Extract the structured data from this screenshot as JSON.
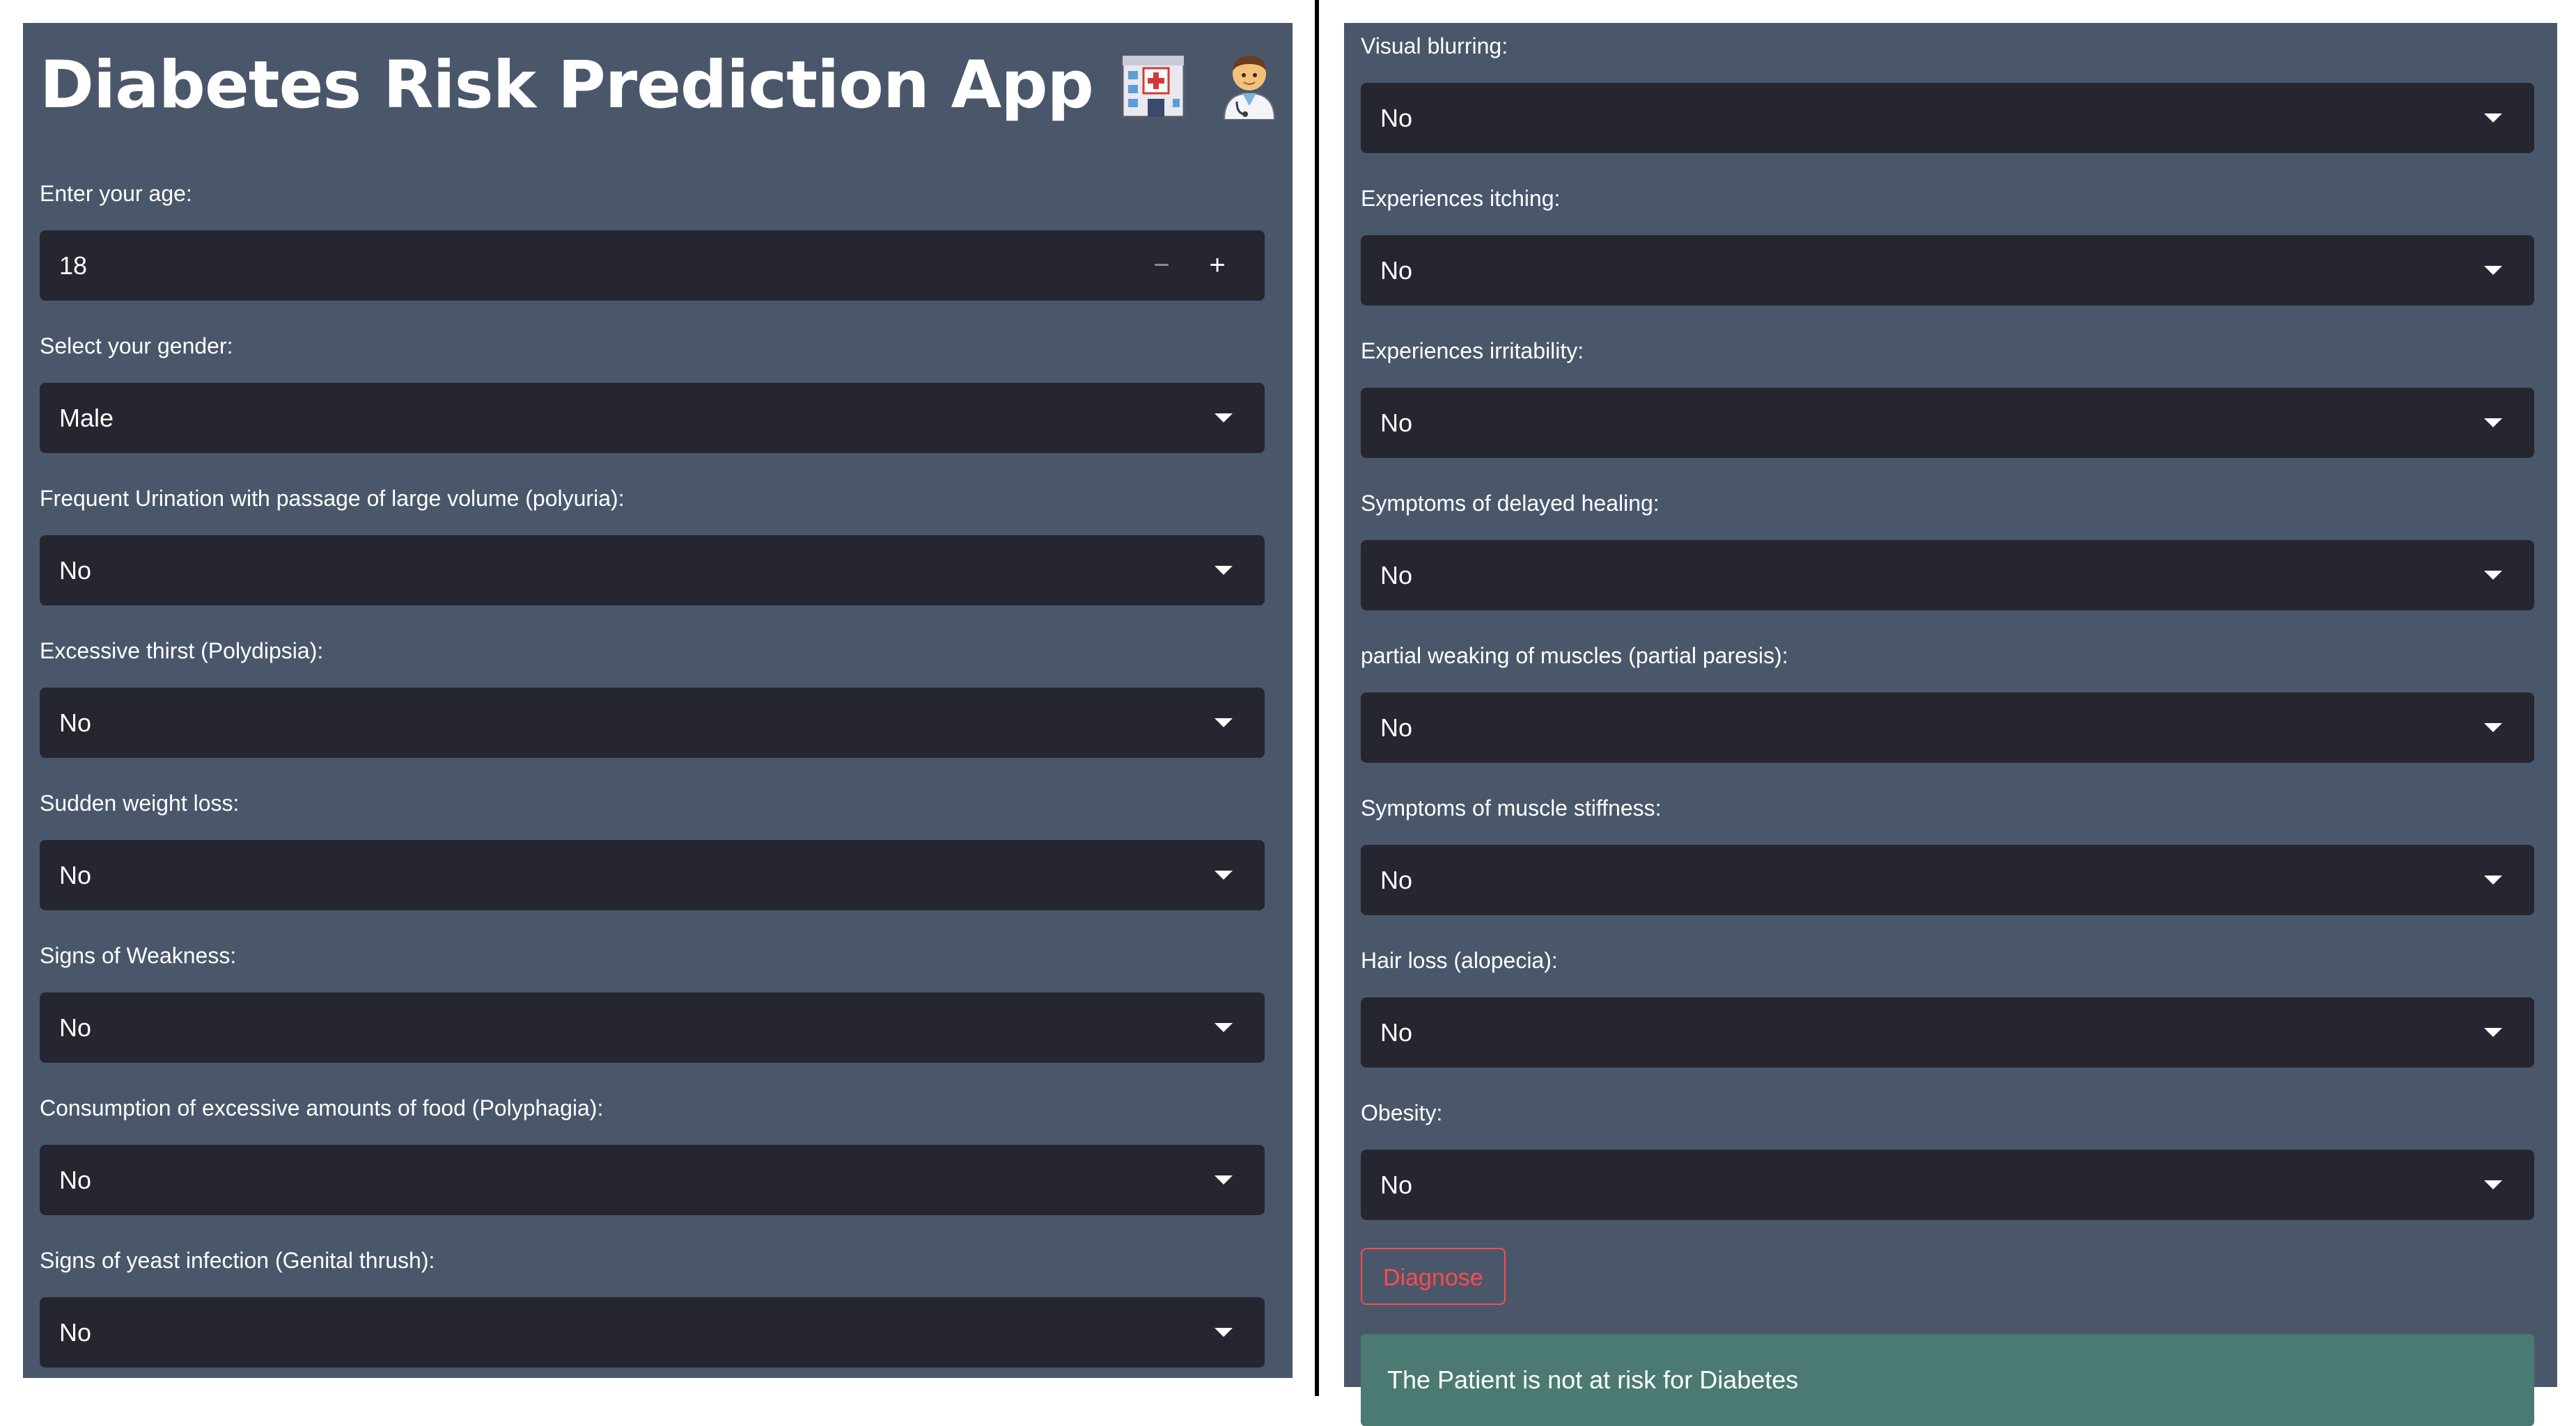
{
  "app": {
    "title": "Diabetes Risk Prediction App",
    "icons": [
      "hospital-icon",
      "health-worker-icon"
    ]
  },
  "age": {
    "label": "Enter your age:",
    "value": "18",
    "decrement": "−",
    "increment": "+"
  },
  "gender": {
    "label": "Select your gender:",
    "value": "Male"
  },
  "left_fields": [
    {
      "label": "Frequent Urination with passage of large volume (polyuria):",
      "value": "No"
    },
    {
      "label": "Excessive thirst (Polydipsia):",
      "value": "No"
    },
    {
      "label": "Sudden weight loss:",
      "value": "No"
    },
    {
      "label": "Signs of Weakness:",
      "value": "No"
    },
    {
      "label": "Consumption of excessive amounts of food (Polyphagia):",
      "value": "No"
    },
    {
      "label": "Signs of yeast infection (Genital thrush):",
      "value": "No"
    }
  ],
  "right_fields": [
    {
      "label": "Visual blurring:",
      "value": "No"
    },
    {
      "label": "Experiences itching:",
      "value": "No"
    },
    {
      "label": "Experiences irritability:",
      "value": "No"
    },
    {
      "label": "Symptoms of delayed healing:",
      "value": "No"
    },
    {
      "label": "partial weaking of muscles (partial paresis):",
      "value": "No"
    },
    {
      "label": "Symptoms of muscle stiffness:",
      "value": "No"
    },
    {
      "label": "Hair loss (alopecia):",
      "value": "No"
    },
    {
      "label": "Obesity:",
      "value": "No"
    }
  ],
  "diagnose_button": "Diagnose",
  "result": "The Patient is not at risk for Diabetes",
  "colors": {
    "panel_bg": "#4a576b",
    "control_bg": "#262630",
    "button_accent": "#ff4b4b",
    "success_bg": "#4a7a72"
  }
}
